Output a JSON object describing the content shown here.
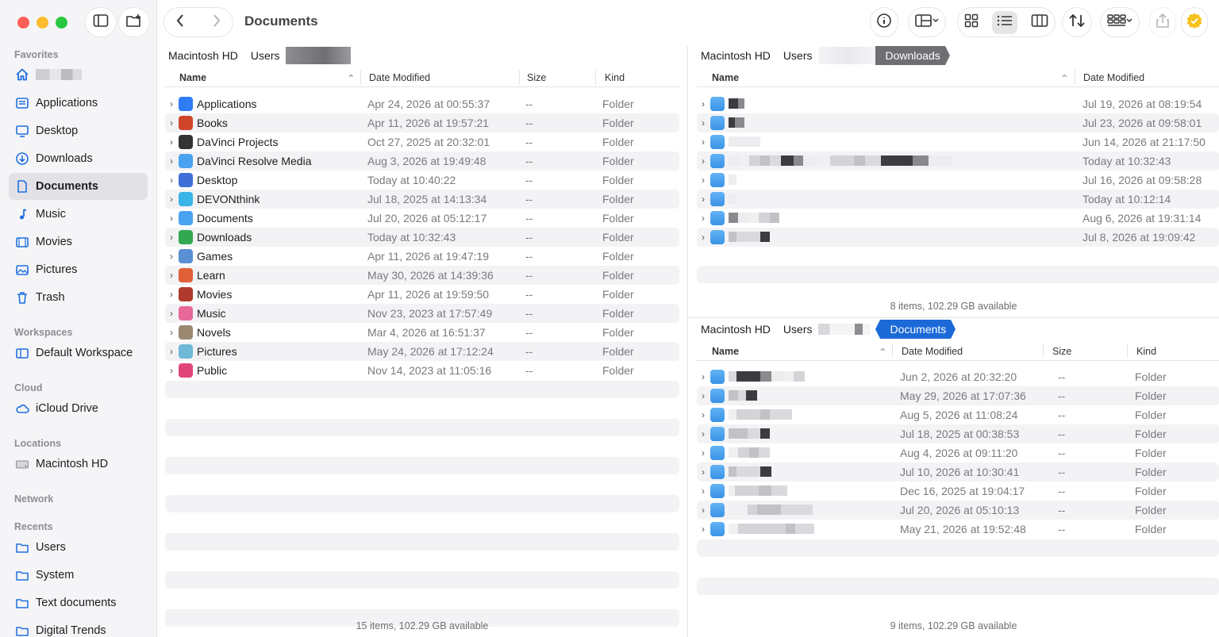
{
  "toolbar": {
    "title": "Documents"
  },
  "sidebar": {
    "favorites_label": "Favorites",
    "items": [
      {
        "label": "Applications",
        "icon": "applications-icon"
      },
      {
        "label": "Desktop",
        "icon": "desktop-icon"
      },
      {
        "label": "Downloads",
        "icon": "downloads-icon"
      },
      {
        "label": "Documents",
        "icon": "documents-icon"
      },
      {
        "label": "Music",
        "icon": "music-icon"
      },
      {
        "label": "Movies",
        "icon": "movies-icon"
      },
      {
        "label": "Pictures",
        "icon": "pictures-icon"
      },
      {
        "label": "Trash",
        "icon": "trash-icon"
      }
    ],
    "workspaces_label": "Workspaces",
    "workspace_item": "Default Workspace",
    "cloud_label": "Cloud",
    "cloud_item": "iCloud Drive",
    "locations_label": "Locations",
    "locations_item": "Macintosh HD",
    "network_label": "Network",
    "recents_label": "Recents",
    "recents": [
      "Users",
      "System",
      "Text documents",
      "Digital Trends"
    ]
  },
  "left_pane": {
    "path": [
      "Macintosh HD",
      "Users"
    ],
    "columns": {
      "name": "Name",
      "date": "Date Modified",
      "size": "Size",
      "kind": "Kind"
    },
    "rows": [
      {
        "name": "Applications",
        "date": "Apr 24, 2026 at 00:55:37",
        "size": "--",
        "kind": "Folder",
        "color": "#2f7cf6"
      },
      {
        "name": "Books",
        "date": "Apr 11, 2026 at 19:57:21",
        "size": "--",
        "kind": "Folder",
        "color": "#d0452a"
      },
      {
        "name": "DaVinci Projects",
        "date": "Oct 27, 2025 at 20:32:01",
        "size": "--",
        "kind": "Folder",
        "color": "#333333"
      },
      {
        "name": "DaVinci Resolve Media",
        "date": "Aug 3, 2026 at 19:49:48",
        "size": "--",
        "kind": "Folder",
        "color": "#4aa3f0"
      },
      {
        "name": "Desktop",
        "date": "Today at 10:40:22",
        "size": "--",
        "kind": "Folder",
        "color": "#3f6fd6"
      },
      {
        "name": "DEVONthink",
        "date": "Jul 18, 2025 at 14:13:34",
        "size": "--",
        "kind": "Folder",
        "color": "#38b4e6"
      },
      {
        "name": "Documents",
        "date": "Jul 20, 2026 at 05:12:17",
        "size": "--",
        "kind": "Folder",
        "color": "#4aa3f0"
      },
      {
        "name": "Downloads",
        "date": "Today at 10:32:43",
        "size": "--",
        "kind": "Folder",
        "color": "#33a852"
      },
      {
        "name": "Games",
        "date": "Apr 11, 2026 at 19:47:19",
        "size": "--",
        "kind": "Folder",
        "color": "#5a8fd6"
      },
      {
        "name": "Learn",
        "date": "May 30, 2026 at 14:39:36",
        "size": "--",
        "kind": "Folder",
        "color": "#e0603a"
      },
      {
        "name": "Movies",
        "date": "Apr 11, 2026 at 19:59:50",
        "size": "--",
        "kind": "Folder",
        "color": "#b03a2e"
      },
      {
        "name": "Music",
        "date": "Nov 23, 2023 at 17:57:49",
        "size": "--",
        "kind": "Folder",
        "color": "#e8689a"
      },
      {
        "name": "Novels",
        "date": "Mar 4, 2026 at 16:51:37",
        "size": "--",
        "kind": "Folder",
        "color": "#9a8870"
      },
      {
        "name": "Pictures",
        "date": "May 24, 2026 at 17:12:24",
        "size": "--",
        "kind": "Folder",
        "color": "#6fb8d8"
      },
      {
        "name": "Public",
        "date": "Nov 14, 2023 at 11:05:16",
        "size": "--",
        "kind": "Folder",
        "color": "#e0457a"
      }
    ],
    "status": "15 items, 102.29 GB available"
  },
  "top_right_pane": {
    "path": [
      "Macintosh HD",
      "Users"
    ],
    "active": "Downloads",
    "columns": {
      "name": "Name",
      "date": "Date Modified"
    },
    "dates": [
      "Jul 19, 2026 at 08:19:54",
      "Jul 23, 2026 at 09:58:01",
      "Jun 14, 2026 at 21:17:50",
      "Today at 10:32:43",
      "Jul 16, 2026 at 09:58:28",
      "Today at 10:12:14",
      "Aug 6, 2026 at 19:31:14",
      "Jul 8, 2026 at 19:09:42"
    ],
    "status": "8 items, 102.29 GB available"
  },
  "bottom_right_pane": {
    "path": [
      "Macintosh HD",
      "Users"
    ],
    "active": "Documents",
    "columns": {
      "name": "Name",
      "date": "Date Modified",
      "size": "Size",
      "kind": "Kind"
    },
    "rows": [
      {
        "date": "Jun 2, 2026 at 20:32:20",
        "size": "--",
        "kind": "Folder"
      },
      {
        "date": "May 29, 2026 at 17:07:36",
        "size": "--",
        "kind": "Folder"
      },
      {
        "date": "Aug 5, 2026 at 11:08:24",
        "size": "--",
        "kind": "Folder"
      },
      {
        "date": "Jul 18, 2025 at 00:38:53",
        "size": "--",
        "kind": "Folder"
      },
      {
        "date": "Aug 4, 2026 at 09:11:20",
        "size": "--",
        "kind": "Folder"
      },
      {
        "date": "Jul 10, 2026 at 10:30:41",
        "size": "--",
        "kind": "Folder"
      },
      {
        "date": "Dec 16, 2025 at 19:04:17",
        "size": "--",
        "kind": "Folder"
      },
      {
        "date": "Jul 20, 2026 at 05:10:13",
        "size": "--",
        "kind": "Folder"
      },
      {
        "date": "May 21, 2026 at 19:52:48",
        "size": "--",
        "kind": "Folder"
      }
    ],
    "status": "9 items, 102.29 GB available"
  }
}
